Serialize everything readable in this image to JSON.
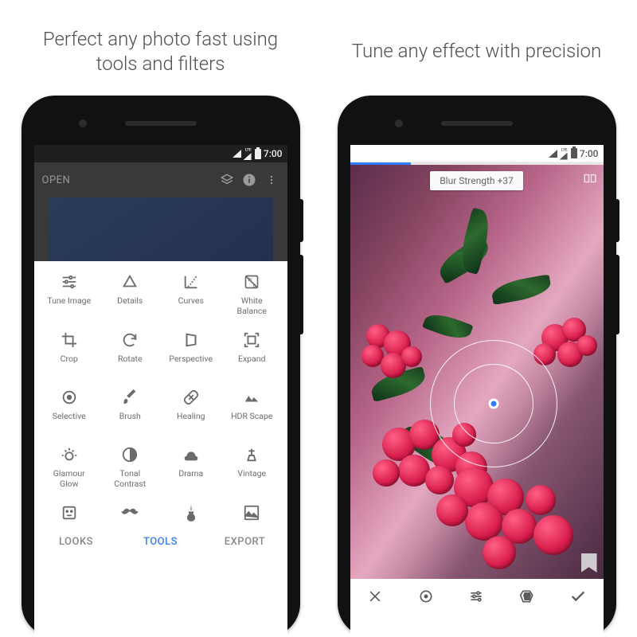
{
  "captions": {
    "left": "Perfect any photo fast using tools and filters",
    "right": "Tune any effect with precision"
  },
  "status": {
    "time": "7:00",
    "net_label": "LTE"
  },
  "phone1": {
    "topbar": {
      "open": "OPEN"
    },
    "tools": [
      {
        "id": "tune-image",
        "label": "Tune Image"
      },
      {
        "id": "details",
        "label": "Details"
      },
      {
        "id": "curves",
        "label": "Curves"
      },
      {
        "id": "white-balance",
        "label": "White\nBalance"
      },
      {
        "id": "crop",
        "label": "Crop"
      },
      {
        "id": "rotate",
        "label": "Rotate"
      },
      {
        "id": "perspective",
        "label": "Perspective"
      },
      {
        "id": "expand",
        "label": "Expand"
      },
      {
        "id": "selective",
        "label": "Selective"
      },
      {
        "id": "brush",
        "label": "Brush"
      },
      {
        "id": "healing",
        "label": "Healing"
      },
      {
        "id": "hdr-scape",
        "label": "HDR Scape"
      },
      {
        "id": "glamour-glow",
        "label": "Glamour\nGlow"
      },
      {
        "id": "tonal-contrast",
        "label": "Tonal\nContrast"
      },
      {
        "id": "drama",
        "label": "Drama"
      },
      {
        "id": "vintage",
        "label": "Vintage"
      }
    ],
    "tools_row5": [
      {
        "id": "face-enhance"
      },
      {
        "id": "mustache"
      },
      {
        "id": "guitar"
      },
      {
        "id": "image"
      }
    ],
    "tabs": {
      "looks": "LOOKS",
      "tools": "TOOLS",
      "export": "EXPORT",
      "active": "tools"
    }
  },
  "phone2": {
    "progress_pct": 24,
    "param_chip": "Blur Strength +37",
    "bottombar": [
      "close",
      "target",
      "sliders",
      "cards",
      "check"
    ]
  }
}
